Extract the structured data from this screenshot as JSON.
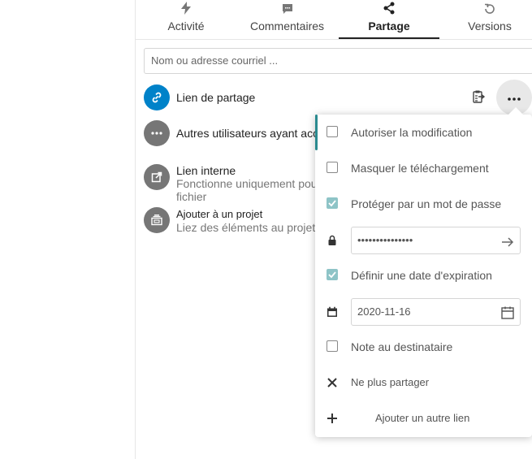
{
  "tabs": [
    {
      "label": "Activité",
      "icon": "lightning-icon"
    },
    {
      "label": "Commentaires",
      "icon": "comment-icon"
    },
    {
      "label": "Partage",
      "icon": "share-icon",
      "active": true
    },
    {
      "label": "Versions",
      "icon": "history-icon"
    }
  ],
  "search": {
    "placeholder": "Nom ou adresse courriel ..."
  },
  "share_rows": {
    "link": {
      "title": "Lien de partage"
    },
    "others": {
      "title": "Autres utilisateurs ayant acc"
    },
    "internal": {
      "title": "Lien interne",
      "subtitle_line1": "Fonctionne uniquement pou",
      "subtitle_line2": "fichier"
    },
    "project": {
      "title": "Ajouter à un projet",
      "subtitle": "Liez des éléments au projet"
    }
  },
  "menu": {
    "allow_edit": {
      "label": "Autoriser la modification",
      "checked": false
    },
    "hide_download": {
      "label": "Masquer le téléchargement",
      "checked": false
    },
    "password_protect": {
      "label": "Protéger par un mot de passe",
      "checked": true
    },
    "password_value": "•••••••••••••••",
    "expiration": {
      "label": "Définir une date d'expiration",
      "checked": true
    },
    "expiration_date": "2020-11-16",
    "note": {
      "label": "Note au destinataire",
      "checked": false
    },
    "unshare": {
      "label": "Ne plus partager"
    },
    "add_link": {
      "label": "Ajouter un autre lien"
    }
  },
  "colors": {
    "accent": "#2a8a8f",
    "checked": "#8ec4c7",
    "link_avatar": "#0082c9",
    "avatar": "#767676"
  }
}
